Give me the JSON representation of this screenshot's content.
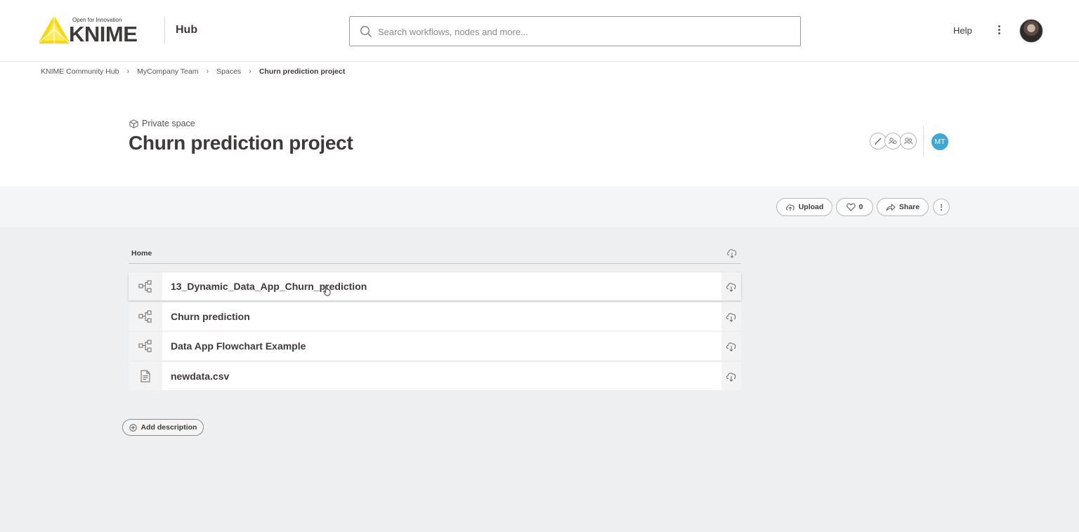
{
  "header": {
    "logo_tagline": "Open for Innovation",
    "logo_text": "KNIME",
    "section": "Hub",
    "search_placeholder": "Search workflows, nodes and more...",
    "help_label": "Help"
  },
  "breadcrumb": [
    "KNIME Community Hub",
    "MyCompany Team",
    "Spaces",
    "Churn prediction project"
  ],
  "space": {
    "type_label": "Private space",
    "title": "Churn prediction project",
    "owner_initials": "MT",
    "owner_color": "#3ca8d6"
  },
  "actions": {
    "upload_label": "Upload",
    "like_count": "0",
    "share_label": "Share"
  },
  "list": {
    "header": "Home",
    "items": [
      {
        "name": "13_Dynamic_Data_App_Churn_prediction",
        "icon": "workflow-icon"
      },
      {
        "name": "Churn prediction",
        "icon": "workflow-icon"
      },
      {
        "name": "Data App Flowchart Example",
        "icon": "workflow-icon"
      },
      {
        "name": "newdata.csv",
        "icon": "file-icon"
      }
    ]
  },
  "add_description_label": "Add description",
  "colors": {
    "brand_yellow": "#fdd800",
    "text_dark": "#3e3a39",
    "content_bg": "#eeeff1"
  }
}
